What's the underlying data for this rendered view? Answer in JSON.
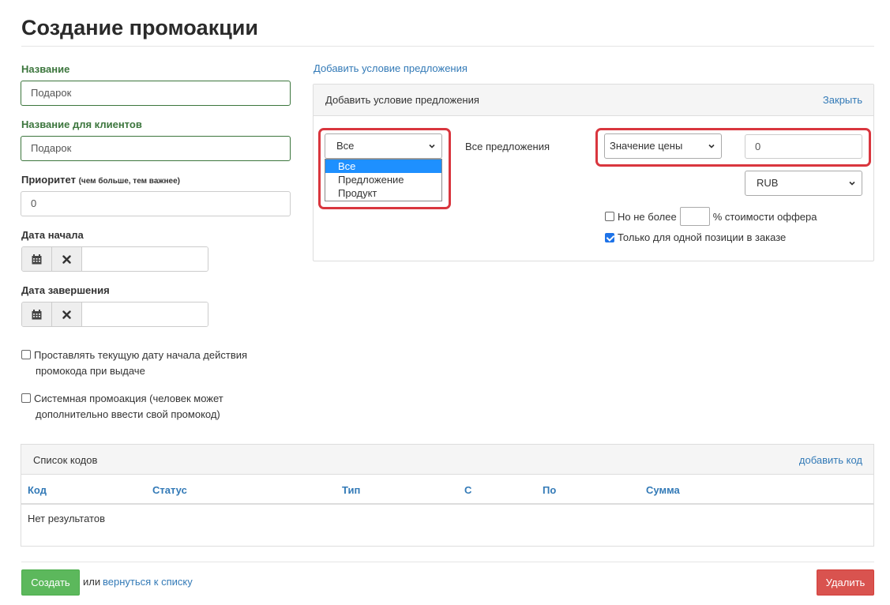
{
  "page_title": "Создание промоакции",
  "form": {
    "name_label": "Название",
    "name_value": "Подарок",
    "client_name_label": "Название для клиентов",
    "client_name_value": "Подарок",
    "priority_label": "Приоритет",
    "priority_hint": "(чем больше, тем важнее)",
    "priority_value": "0",
    "start_date_label": "Дата начала",
    "end_date_label": "Дата завершения",
    "checkbox_current_date_line1": "Проставлять текущую дату начала действия",
    "checkbox_current_date_line2": "промокода при выдаче",
    "checkbox_system_line1": "Системная промоакция (человек может",
    "checkbox_system_line2": "дополнительно ввести свой промокод)"
  },
  "condition": {
    "add_link": "Добавить условие предложения",
    "panel_title": "Добавить условие предложения",
    "close_label": "Закрыть",
    "scope_selected": "Все",
    "scope_options": [
      "Все",
      "Предложение",
      "Продукт"
    ],
    "scope_text": "Все предложения",
    "price_type_selected": "Значение цены",
    "price_value": "0",
    "currency_selected": "RUB",
    "not_more_label": "Но не более",
    "percent_label": "% стоимости оффера",
    "single_position_label": "Только для одной позиции в заказе",
    "single_position_checked": true
  },
  "codes": {
    "title": "Список кодов",
    "add_label": "добавить код",
    "columns": [
      "Код",
      "Статус",
      "Тип",
      "С",
      "По",
      "Сумма"
    ],
    "empty_text": "Нет результатов"
  },
  "actions": {
    "create_label": "Создать",
    "or_text": "или",
    "back_link": "вернуться к списку",
    "delete_label": "Удалить"
  },
  "colors": {
    "accent_green": "#3c763d",
    "link_blue": "#337ab7",
    "highlight_red": "#d9363e",
    "create_button": "#5cb85c",
    "delete_button": "#d9534f"
  }
}
